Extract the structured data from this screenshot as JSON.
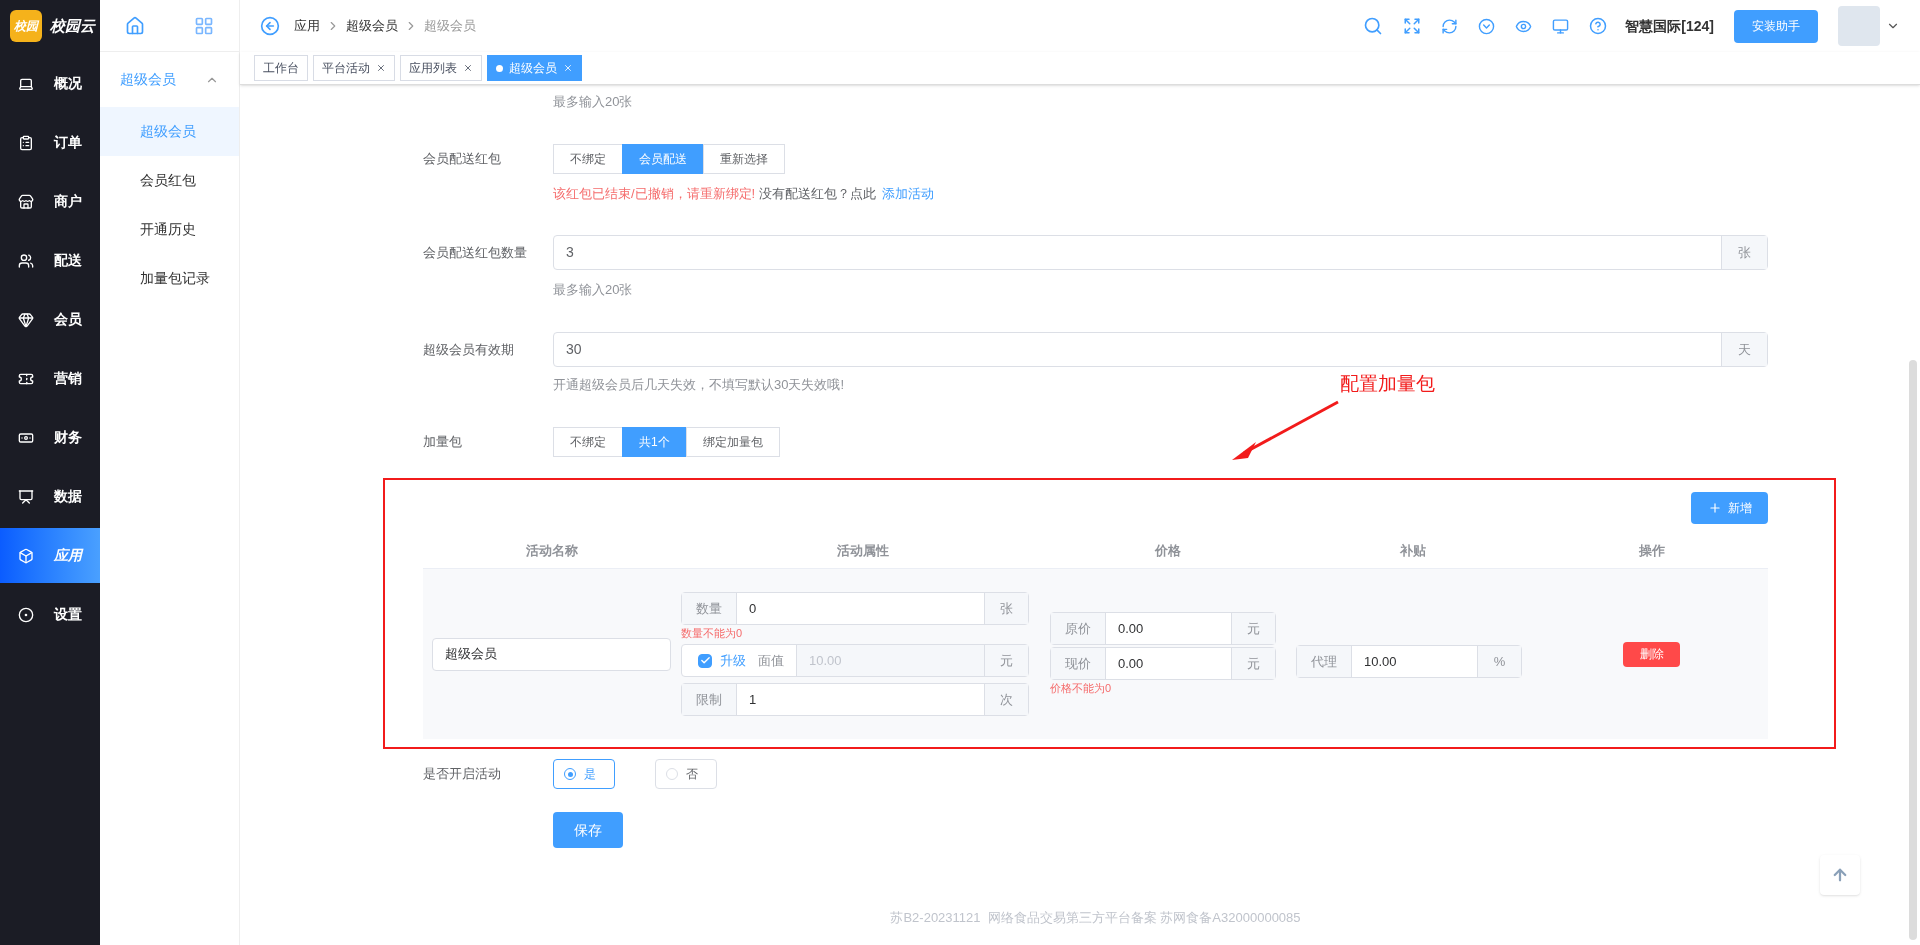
{
  "sidebar": {
    "logo": {
      "badge": "校园",
      "name": "校园云"
    },
    "items": [
      {
        "label": "概况",
        "selected": false
      },
      {
        "label": "订单",
        "selected": false
      },
      {
        "label": "商户",
        "selected": false
      },
      {
        "label": "配送",
        "selected": false
      },
      {
        "label": "会员",
        "selected": false
      },
      {
        "label": "营销",
        "selected": false
      },
      {
        "label": "财务",
        "selected": false
      },
      {
        "label": "数据",
        "selected": false
      },
      {
        "label": "应用",
        "selected": true
      },
      {
        "label": "设置",
        "selected": false
      }
    ]
  },
  "subnav": {
    "group": {
      "label": "超级会员",
      "expanded": true
    },
    "items": [
      {
        "label": "超级会员",
        "selected": true
      },
      {
        "label": "会员红包",
        "selected": false
      },
      {
        "label": "开通历史",
        "selected": false
      },
      {
        "label": "加量包记录",
        "selected": false
      }
    ]
  },
  "breadcrumb": [
    "应用",
    "超级会员",
    "超级会员"
  ],
  "header": {
    "org": "智慧国际[124]",
    "install_button": "安装助手"
  },
  "tabs": [
    {
      "label": "工作台",
      "selected": false,
      "closable": false
    },
    {
      "label": "平台活动",
      "selected": false,
      "closable": true
    },
    {
      "label": "应用列表",
      "selected": false,
      "closable": true
    },
    {
      "label": "超级会员",
      "selected": true,
      "closable": true
    }
  ],
  "form": {
    "top_hint": "最多输入20张",
    "red_packet": {
      "label": "会员配送红包",
      "options": [
        {
          "label": "不绑定",
          "selected": false
        },
        {
          "label": "会员配送",
          "selected": true
        },
        {
          "label": "重新选择",
          "selected": false
        }
      ],
      "error": "该红包已结束/已撤销，请重新绑定!",
      "note": "没有配送红包？点此",
      "link": "添加活动"
    },
    "count": {
      "label": "会员配送红包数量",
      "value": "3",
      "unit": "张",
      "hint": "最多输入20张"
    },
    "validity": {
      "label": "超级会员有效期",
      "value": "30",
      "unit": "天",
      "hint": "开通超级会员后几天失效，不填写默认30天失效哦!"
    },
    "bundle": {
      "label": "加量包",
      "options": [
        {
          "label": "不绑定",
          "selected": false
        },
        {
          "label": "共1个",
          "selected": true
        },
        {
          "label": "绑定加量包",
          "selected": false
        }
      ]
    },
    "bundle_table": {
      "add_button": "新增",
      "columns": [
        "活动名称",
        "活动属性",
        "价格",
        "补贴",
        "操作"
      ],
      "rows": [
        {
          "name": "超级会员",
          "quantity": {
            "label": "数量",
            "value": "0",
            "unit": "张",
            "error": "数量不能为0"
          },
          "upgrade": {
            "checked": true,
            "label": "升级",
            "field_label": "面值",
            "placeholder": "10.00",
            "unit": "元"
          },
          "limit": {
            "label": "限制",
            "value": "1",
            "unit": "次"
          },
          "original_price": {
            "label": "原价",
            "value": "0.00",
            "unit": "元"
          },
          "current_price": {
            "label": "现价",
            "value": "0.00",
            "unit": "元",
            "error": "价格不能为0"
          },
          "subsidy": {
            "label": "代理",
            "value": "10.00",
            "unit": "%"
          },
          "delete_button": "删除"
        }
      ]
    },
    "activity": {
      "label": "是否开启活动",
      "options": [
        {
          "label": "是",
          "selected": true
        },
        {
          "label": "否",
          "selected": false
        }
      ]
    },
    "save_button": "保存"
  },
  "annotation": {
    "text": "配置加量包"
  },
  "footer": "苏B2-20231121  网络食品交易第三方平台备案 苏网食备A32000000085"
}
